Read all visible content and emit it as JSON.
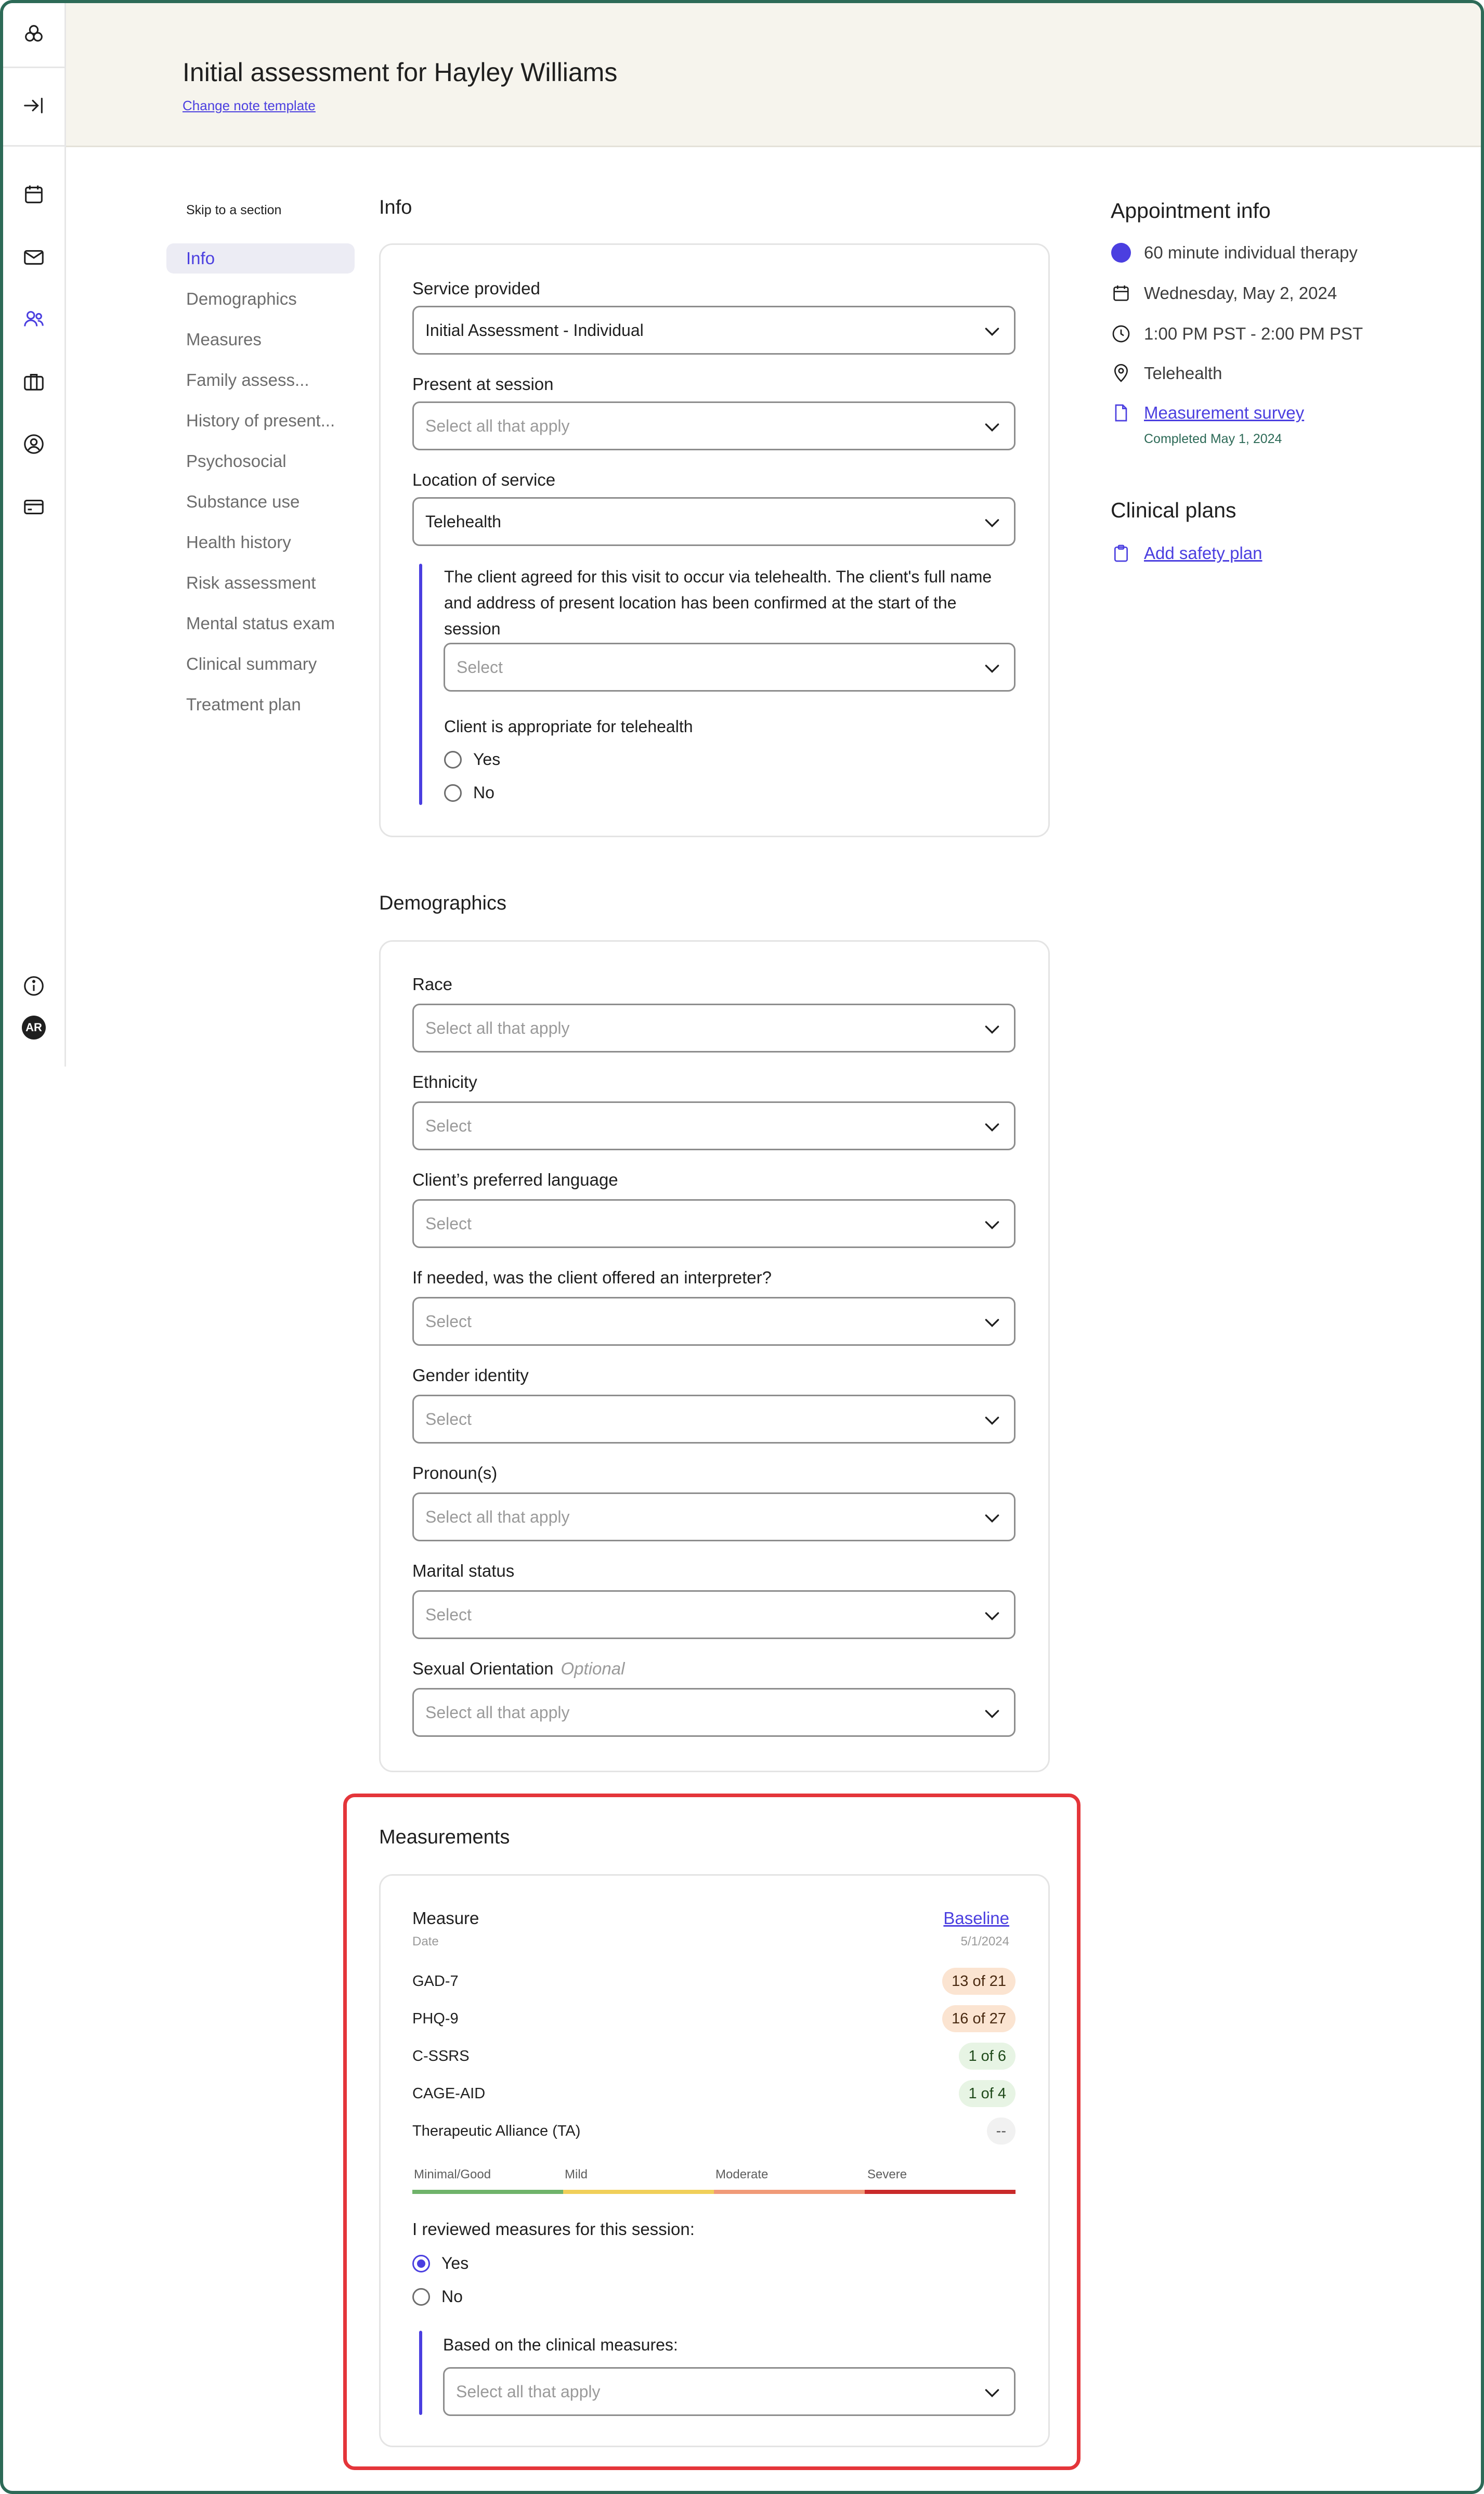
{
  "header": {
    "title": "Initial assessment for Hayley Williams",
    "change_template": "Change note template"
  },
  "rail": {
    "icons": [
      "logo-icon",
      "collapse-sidebar-icon",
      "calendar-icon",
      "mail-icon",
      "clients-icon",
      "briefcase-icon",
      "profile-icon",
      "billing-card-icon",
      "info-icon"
    ],
    "avatar_initials": "AR"
  },
  "nav": {
    "skip_label": "Skip to a section",
    "items": [
      "Info",
      "Demographics",
      "Measures",
      "Family assess...",
      "History of present...",
      "Psychosocial",
      "Substance use",
      "Health history",
      "Risk assessment",
      "Mental status exam",
      "Clinical summary",
      "Treatment plan"
    ],
    "active_index": 0
  },
  "info": {
    "section_title": "Info",
    "service_label": "Service provided",
    "service_value": "Initial Assessment - Individual",
    "present_label": "Present at session",
    "present_placeholder": "Select all that apply",
    "location_label": "Location of service",
    "location_value": "Telehealth",
    "telehealth_text": "The client agreed for this visit to occur via telehealth. The client's full name and address of present location has been confirmed at the start of the session",
    "telehealth_placeholder": "Select",
    "appropriate_label": "Client is appropriate for telehealth",
    "yes": "Yes",
    "no": "No"
  },
  "demographics": {
    "section_title": "Demographics",
    "race_label": "Race",
    "race_placeholder": "Select all that apply",
    "ethnicity_label": "Ethnicity",
    "ethnicity_placeholder": "Select",
    "language_label": "Client’s preferred language",
    "language_placeholder": "Select",
    "interpreter_label": "If needed, was the client offered an interpreter?",
    "interpreter_placeholder": "Select",
    "gender_label": "Gender identity",
    "gender_placeholder": "Select",
    "pronouns_label": "Pronoun(s)",
    "pronouns_placeholder": "Select all that apply",
    "marital_label": "Marital status",
    "marital_placeholder": "Select",
    "orientation_label": "Sexual Orientation",
    "orientation_optional": "Optional",
    "orientation_placeholder": "Select all that apply"
  },
  "measurements": {
    "section_title": "Measurements",
    "measure_header": "Measure",
    "date_header": "Date",
    "baseline_link": "Baseline",
    "baseline_date": "5/1/2024",
    "rows": [
      {
        "name": "GAD-7",
        "score": "13 of 21",
        "severity": "orange"
      },
      {
        "name": "PHQ-9",
        "score": "16 of 27",
        "severity": "orange"
      },
      {
        "name": "C-SSRS",
        "score": "1 of 6",
        "severity": "green"
      },
      {
        "name": "CAGE-AID",
        "score": "1 of 4",
        "severity": "green"
      },
      {
        "name": "Therapeutic Alliance (TA)",
        "score": "--",
        "severity": "grey"
      }
    ],
    "scale": {
      "labels": [
        "Minimal/Good",
        "Mild",
        "Moderate",
        "Severe"
      ],
      "colors": [
        "#6fb36a",
        "#f0cf5a",
        "#f09a78",
        "#c92a2a"
      ]
    },
    "reviewed_label": "I reviewed measures for this session:",
    "yes": "Yes",
    "no": "No",
    "selected": "Yes",
    "based_label": "Based on the clinical measures:",
    "based_placeholder": "Select all that apply"
  },
  "appointment": {
    "title": "Appointment info",
    "type": "60 minute individual therapy",
    "date": "Wednesday, May 2, 2024",
    "time": "1:00 PM PST - 2:00 PM PST",
    "location": "Telehealth",
    "survey_link": "Measurement survey",
    "survey_status": "Completed May 1, 2024"
  },
  "clinical_plans": {
    "title": "Clinical plans",
    "safety_link": "Add safety plan"
  },
  "colors": {
    "accent": "#4b3fe0",
    "header_bg": "#f6f4ed",
    "highlight": "#e4353a",
    "frame": "#2d6a57"
  }
}
